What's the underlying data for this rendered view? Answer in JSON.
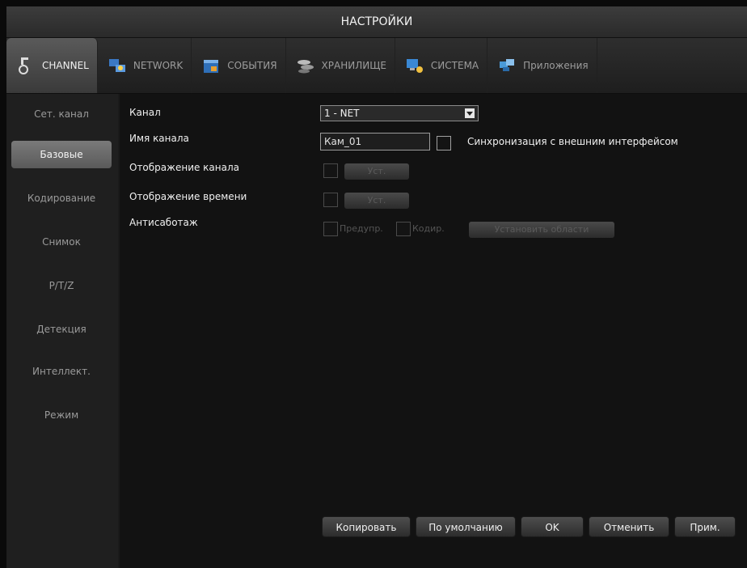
{
  "window": {
    "title": "НАСТРОЙКИ"
  },
  "tabs": [
    {
      "label": "CHANNEL",
      "icon": "camera-icon"
    },
    {
      "label": "NETWORK",
      "icon": "network-icon"
    },
    {
      "label": "СОБЫТИЯ",
      "icon": "calendar-icon"
    },
    {
      "label": "ХРАНИЛИЩЕ",
      "icon": "storage-icon"
    },
    {
      "label": "СИСТЕМА",
      "icon": "system-icon"
    },
    {
      "label": "Приложения",
      "icon": "apps-icon"
    }
  ],
  "sidebar": {
    "items": [
      {
        "label": "Сет. канал"
      },
      {
        "label": "Базовые"
      },
      {
        "label": "Кодирование"
      },
      {
        "label": "Снимок"
      },
      {
        "label": "P/T/Z"
      },
      {
        "label": "Детекция"
      },
      {
        "label": "Интеллект."
      },
      {
        "label": "Режим"
      }
    ],
    "active_index": 1
  },
  "form": {
    "channel_label": "Канал",
    "channel_value": "1 - NET",
    "channel_name_label": "Имя канала",
    "channel_name_value": "Кам_01",
    "sync_label": "Синхронизация с внешним интерфейсом",
    "show_channel_label": "Отображение канала",
    "show_channel_button": "Уст.",
    "show_time_label": "Отображение времени",
    "show_time_button": "Уст.",
    "antisabotage_label": "Антисаботаж",
    "antisabotage_warn": "Предупр.",
    "antisabotage_code": "Кодир.",
    "antisabotage_button": "Установить области"
  },
  "footer": {
    "copy": "Копировать",
    "default": "По умолчанию",
    "ok": "OK",
    "cancel": "Отменить",
    "apply": "Прим."
  },
  "colors": {
    "active_tab": "#4a4a4a",
    "active_sidebar": "#6a6a6a",
    "background": "#121212"
  }
}
